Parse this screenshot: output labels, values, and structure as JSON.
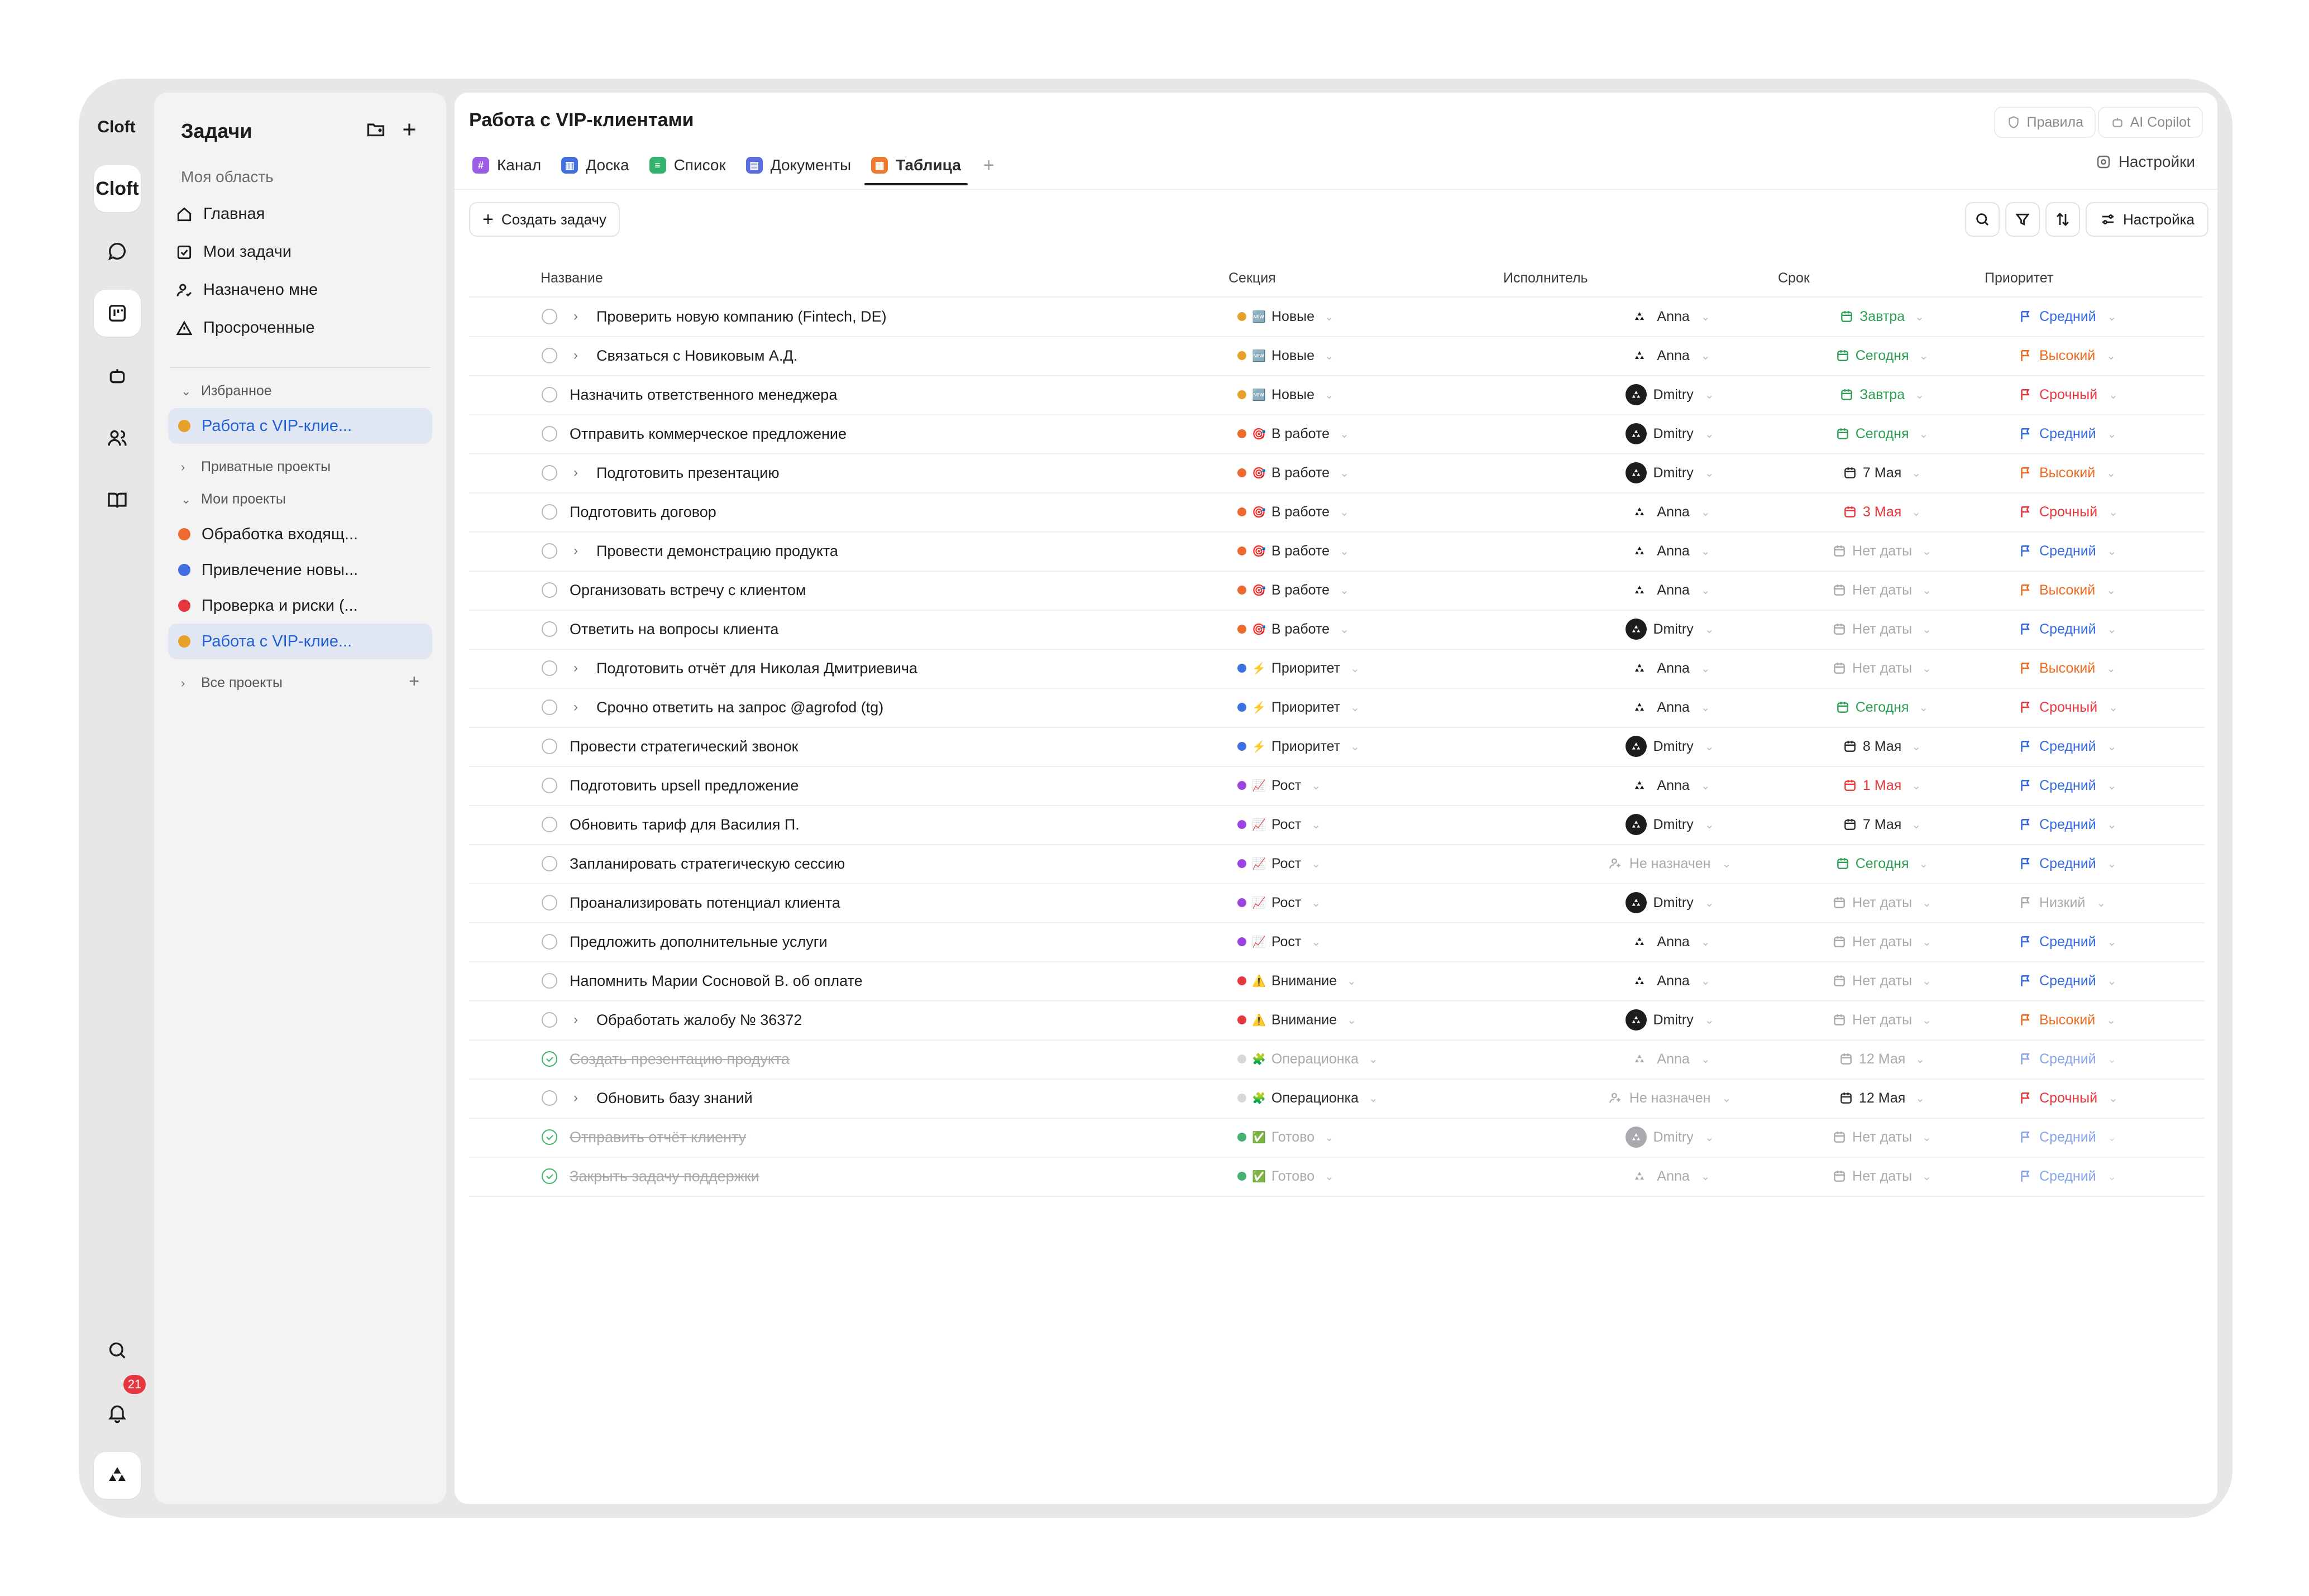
{
  "rail": {
    "app_name": "Cloft",
    "workspace": "Cloft",
    "icons": [
      "chat-icon",
      "tasks-board-icon",
      "bot-icon",
      "people-icon",
      "book-icon",
      "search-icon",
      "bell-icon",
      "user-avatar-icon"
    ],
    "notification_count": "21"
  },
  "sidebar": {
    "title": "Задачи",
    "area_label": "Моя область",
    "nav": [
      {
        "label": "Главная",
        "icon": "home-icon"
      },
      {
        "label": "Мои задачи",
        "icon": "checkbox-icon"
      },
      {
        "label": "Назначено мне",
        "icon": "user-assigned-icon"
      },
      {
        "label": "Просроченные",
        "icon": "warning-icon"
      }
    ],
    "favorites_label": "Избранное",
    "favorites": [
      {
        "label": "Работа с VIP-клие...",
        "color": "#e5a12a"
      }
    ],
    "private_label": "Приватные проекты",
    "my_projects_label": "Мои проекты",
    "projects": [
      {
        "label": "Обработка входящ...",
        "color": "#ef6a2f"
      },
      {
        "label": "Привлечение новы...",
        "color": "#3f6fe0"
      },
      {
        "label": "Проверка и риски (...",
        "color": "#e5373d"
      },
      {
        "label": "Работа с VIP-клие...",
        "color": "#e5a12a"
      }
    ],
    "all_projects_label": "Все проекты"
  },
  "header": {
    "title": "Работа с VIP-клиентами",
    "rules_label": "Правила",
    "copilot_label": "AI Copilot",
    "settings_label": "Настройки",
    "tabs": [
      {
        "label": "Канал",
        "color": "#9b5de5",
        "glyph": "#"
      },
      {
        "label": "Доска",
        "color": "#3f6fe0",
        "glyph": "▥"
      },
      {
        "label": "Список",
        "color": "#33b36b",
        "glyph": "≡"
      },
      {
        "label": "Документы",
        "color": "#5a6ee0",
        "glyph": "▤"
      },
      {
        "label": "Таблица",
        "color": "#ef7a2f",
        "glyph": "▦"
      }
    ],
    "active_tab": "Таблица"
  },
  "toolbar": {
    "create_label": "Создать задачу",
    "settings_label": "Настройка"
  },
  "columns": {
    "name": "Название",
    "section": "Секция",
    "assignee": "Исполнитель",
    "due": "Срок",
    "priority": "Приоритет"
  },
  "colors": {
    "green": "#2e9e55",
    "red": "#e5373d",
    "orange": "#ee6a1f",
    "blue": "#3569e0",
    "gray": "#a9a9ae",
    "dark": "#2a2a2e"
  },
  "rows": [
    {
      "name": "Проверить новую компанию (Fintech, DE)",
      "expand": true,
      "done": false,
      "section": "Новые",
      "section_emoji": "🆕",
      "section_color": "#e5a12a",
      "assignee": "Anna",
      "avatar": "light",
      "due": "Завтра",
      "due_tone": "green",
      "priority": "Средний",
      "pri_tone": "blue"
    },
    {
      "name": "Связаться с Новиковым А.Д.",
      "expand": true,
      "done": false,
      "section": "Новые",
      "section_emoji": "🆕",
      "section_color": "#e5a12a",
      "assignee": "Anna",
      "avatar": "light",
      "due": "Сегодня",
      "due_tone": "green",
      "priority": "Высокий",
      "pri_tone": "orange"
    },
    {
      "name": "Назначить ответственного менеджера",
      "expand": false,
      "done": false,
      "section": "Новые",
      "section_emoji": "🆕",
      "section_color": "#e5a12a",
      "assignee": "Dmitry",
      "avatar": "dark",
      "due": "Завтра",
      "due_tone": "green",
      "priority": "Срочный",
      "pri_tone": "red"
    },
    {
      "name": "Отправить коммерческое предложение",
      "expand": false,
      "done": false,
      "section": "В работе",
      "section_emoji": "🎯",
      "section_color": "#ef6a2f",
      "assignee": "Dmitry",
      "avatar": "dark",
      "due": "Сегодня",
      "due_tone": "green",
      "priority": "Средний",
      "pri_tone": "blue"
    },
    {
      "name": "Подготовить презентацию",
      "expand": true,
      "done": false,
      "section": "В работе",
      "section_emoji": "🎯",
      "section_color": "#ef6a2f",
      "assignee": "Dmitry",
      "avatar": "dark",
      "due": "7 Мая",
      "due_tone": "dark",
      "priority": "Высокий",
      "pri_tone": "orange"
    },
    {
      "name": "Подготовить договор",
      "expand": false,
      "done": false,
      "section": "В работе",
      "section_emoji": "🎯",
      "section_color": "#ef6a2f",
      "assignee": "Anna",
      "avatar": "light",
      "due": "3 Мая",
      "due_tone": "red",
      "priority": "Срочный",
      "pri_tone": "red"
    },
    {
      "name": "Провести демонстрацию продукта",
      "expand": true,
      "done": false,
      "section": "В работе",
      "section_emoji": "🎯",
      "section_color": "#ef6a2f",
      "assignee": "Anna",
      "avatar": "light",
      "due": "Нет даты",
      "due_tone": "gray",
      "priority": "Средний",
      "pri_tone": "blue"
    },
    {
      "name": "Организовать встречу с клиентом",
      "expand": false,
      "done": false,
      "section": "В работе",
      "section_emoji": "🎯",
      "section_color": "#ef6a2f",
      "assignee": "Anna",
      "avatar": "light",
      "due": "Нет даты",
      "due_tone": "gray",
      "priority": "Высокий",
      "pri_tone": "orange"
    },
    {
      "name": "Ответить на вопросы клиента",
      "expand": false,
      "done": false,
      "section": "В работе",
      "section_emoji": "🎯",
      "section_color": "#ef6a2f",
      "assignee": "Dmitry",
      "avatar": "dark",
      "due": "Нет даты",
      "due_tone": "gray",
      "priority": "Средний",
      "pri_tone": "blue"
    },
    {
      "name": "Подготовить отчёт для Николая Дмитриевича",
      "expand": true,
      "done": false,
      "section": "Приоритет",
      "section_emoji": "⚡",
      "section_color": "#3f6fe0",
      "assignee": "Anna",
      "avatar": "light",
      "due": "Нет даты",
      "due_tone": "gray",
      "priority": "Высокий",
      "pri_tone": "orange"
    },
    {
      "name": "Срочно ответить на запрос @agrofod (tg)",
      "expand": true,
      "done": false,
      "section": "Приоритет",
      "section_emoji": "⚡",
      "section_color": "#3f6fe0",
      "assignee": "Anna",
      "avatar": "light",
      "due": "Сегодня",
      "due_tone": "green",
      "priority": "Срочный",
      "pri_tone": "red"
    },
    {
      "name": "Провести стратегический звонок",
      "expand": false,
      "done": false,
      "section": "Приоритет",
      "section_emoji": "⚡",
      "section_color": "#3f6fe0",
      "assignee": "Dmitry",
      "avatar": "dark",
      "due": "8 Мая",
      "due_tone": "dark",
      "priority": "Средний",
      "pri_tone": "blue"
    },
    {
      "name": "Подготовить upsell предложение",
      "expand": false,
      "done": false,
      "section": "Рост",
      "section_emoji": "📈",
      "section_color": "#9b45e0",
      "assignee": "Anna",
      "avatar": "light",
      "due": "1 Мая",
      "due_tone": "red",
      "priority": "Средний",
      "pri_tone": "blue"
    },
    {
      "name": "Обновить тариф для Василия П.",
      "expand": false,
      "done": false,
      "section": "Рост",
      "section_emoji": "📈",
      "section_color": "#9b45e0",
      "assignee": "Dmitry",
      "avatar": "dark",
      "due": "7 Мая",
      "due_tone": "dark",
      "priority": "Средний",
      "pri_tone": "blue"
    },
    {
      "name": "Запланировать стратегическую сессию",
      "expand": false,
      "done": false,
      "section": "Рост",
      "section_emoji": "📈",
      "section_color": "#9b45e0",
      "assignee": "Не назначен",
      "avatar": "none",
      "due": "Сегодня",
      "due_tone": "green",
      "priority": "Средний",
      "pri_tone": "blue"
    },
    {
      "name": "Проанализировать потенциал клиента",
      "expand": false,
      "done": false,
      "section": "Рост",
      "section_emoji": "📈",
      "section_color": "#9b45e0",
      "assignee": "Dmitry",
      "avatar": "dark",
      "due": "Нет даты",
      "due_tone": "gray",
      "priority": "Низкий",
      "pri_tone": "gray"
    },
    {
      "name": "Предложить дополнительные услуги",
      "expand": false,
      "done": false,
      "section": "Рост",
      "section_emoji": "📈",
      "section_color": "#9b45e0",
      "assignee": "Anna",
      "avatar": "light",
      "due": "Нет даты",
      "due_tone": "gray",
      "priority": "Средний",
      "pri_tone": "blue"
    },
    {
      "name": "Напомнить Марии Сосновой В. об оплате",
      "expand": false,
      "done": false,
      "section": "Внимание",
      "section_emoji": "⚠️",
      "section_color": "#e5373d",
      "assignee": "Anna",
      "avatar": "light",
      "due": "Нет даты",
      "due_tone": "gray",
      "priority": "Средний",
      "pri_tone": "blue"
    },
    {
      "name": "Обработать жалобу № 36372",
      "expand": true,
      "done": false,
      "section": "Внимание",
      "section_emoji": "⚠️",
      "section_color": "#e5373d",
      "assignee": "Dmitry",
      "avatar": "dark",
      "due": "Нет даты",
      "due_tone": "gray",
      "priority": "Высокий",
      "pri_tone": "orange"
    },
    {
      "name": "Создать презентацию продукта",
      "expand": false,
      "done": true,
      "section": "Операционка",
      "section_emoji": "🧩",
      "section_color": "#d8d8dc",
      "assignee": "Anna",
      "avatar": "light",
      "due": "12 Мая",
      "due_tone": "gray",
      "priority": "Средний",
      "pri_tone": "blue"
    },
    {
      "name": "Обновить базу знаний",
      "expand": true,
      "done": false,
      "section": "Операционка",
      "section_emoji": "🧩",
      "section_color": "#d8d8dc",
      "assignee": "Не назначен",
      "avatar": "none",
      "due": "12 Мая",
      "due_tone": "dark",
      "priority": "Срочный",
      "pri_tone": "red"
    },
    {
      "name": "Отправить отчёт клиенту",
      "expand": false,
      "done": true,
      "section": "Готово",
      "section_emoji": "✅",
      "section_color": "#45b36b",
      "assignee": "Dmitry",
      "avatar": "dark",
      "due": "Нет даты",
      "due_tone": "gray",
      "priority": "Средний",
      "pri_tone": "blue"
    },
    {
      "name": "Закрыть задачу поддержки",
      "expand": false,
      "done": true,
      "section": "Готово",
      "section_emoji": "✅",
      "section_color": "#45b36b",
      "assignee": "Anna",
      "avatar": "light",
      "due": "Нет даты",
      "due_tone": "gray",
      "priority": "Средний",
      "pri_tone": "blue"
    }
  ]
}
